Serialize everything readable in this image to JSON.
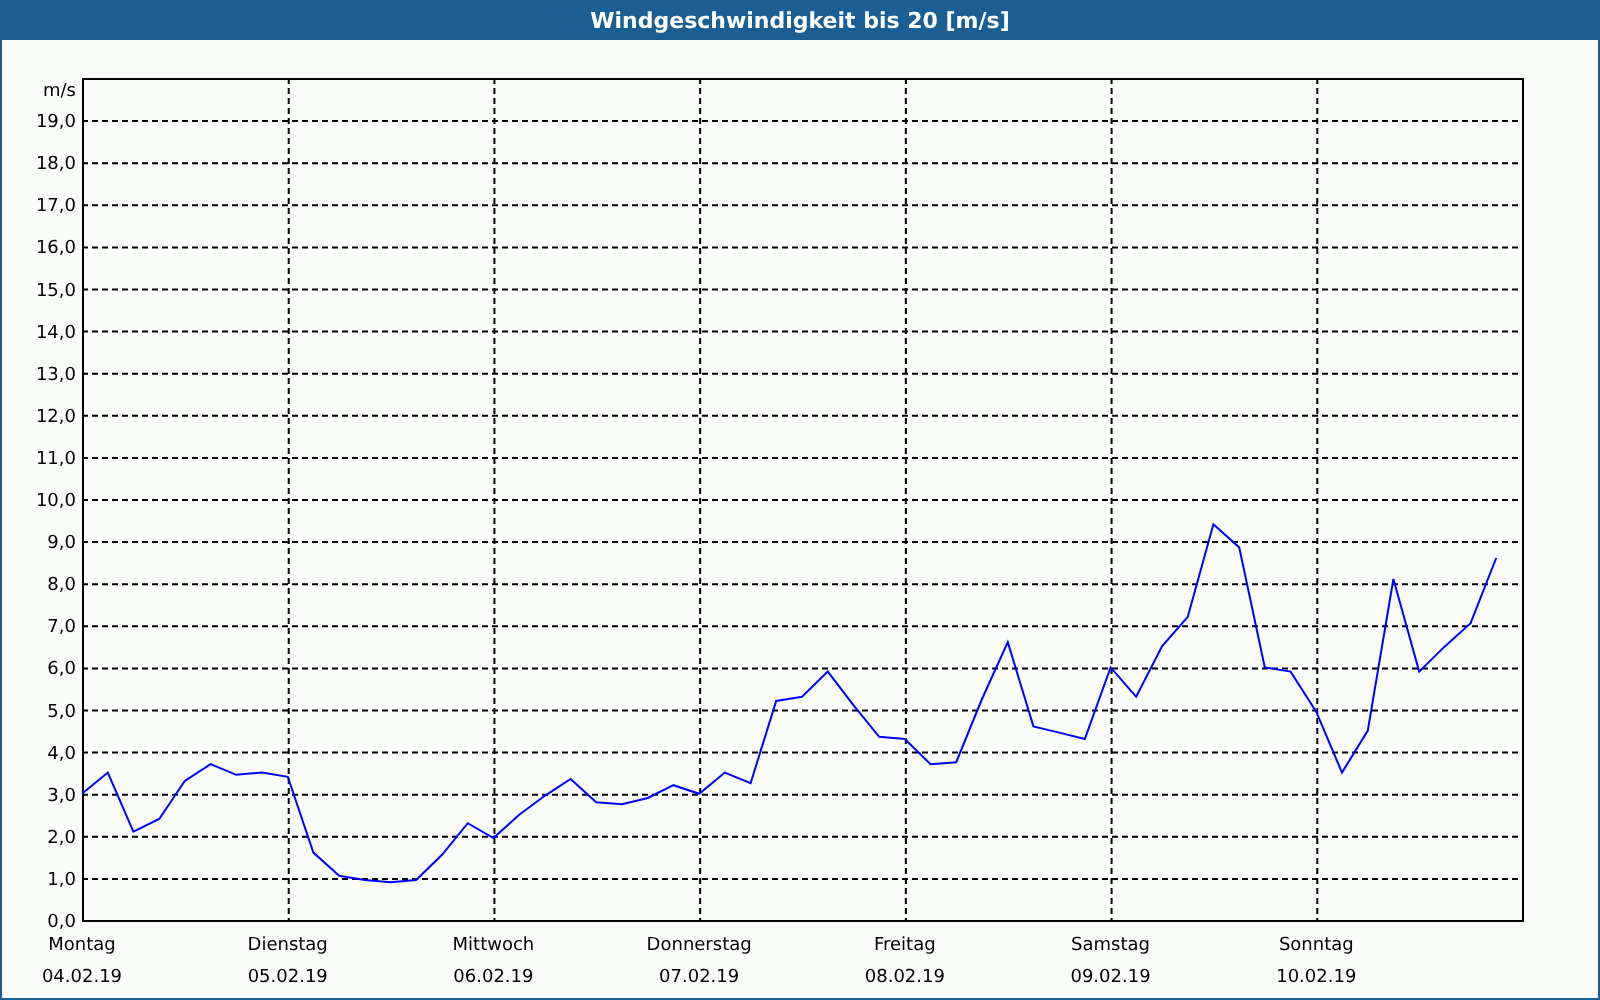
{
  "window": {
    "title": "Windgeschwindigkeit bis 20 [m/s]"
  },
  "chart": {
    "chart_data": {
      "type": "line",
      "grid": true,
      "ylabel": "m/s",
      "ylim": [
        0,
        20
      ],
      "categories": [
        "Montag\n04.02.19",
        null,
        null,
        null,
        null,
        null,
        null,
        null,
        "Dienstag\n05.02.19",
        null,
        null,
        null,
        null,
        null,
        null,
        null,
        "Mittwoch\n06.02.19",
        null,
        null,
        null,
        null,
        null,
        null,
        null,
        "Donnerstag\n07.02.19",
        null,
        null,
        null,
        null,
        null,
        null,
        null,
        "Freitag\n08.02.19",
        null,
        null,
        null,
        null,
        null,
        null,
        null,
        "Samstag\n09.02.19",
        null,
        null,
        null,
        null,
        null,
        null,
        null,
        "Sonntag\n10.02.19",
        null,
        null,
        null,
        null,
        null,
        null,
        null
      ],
      "yticks": [
        {
          "value": 0,
          "label": "0,0"
        },
        {
          "value": 1,
          "label": "1,0"
        },
        {
          "value": 2,
          "label": "2,0"
        },
        {
          "value": 3,
          "label": "3,0"
        },
        {
          "value": 4,
          "label": "4,0"
        },
        {
          "value": 5,
          "label": "5,0"
        },
        {
          "value": 6,
          "label": "6,0"
        },
        {
          "value": 7,
          "label": "7,0"
        },
        {
          "value": 8,
          "label": "8,0"
        },
        {
          "value": 9,
          "label": "9,0"
        },
        {
          "value": 10,
          "label": "10,0"
        },
        {
          "value": 11,
          "label": "11,0"
        },
        {
          "value": 12,
          "label": "12,0"
        },
        {
          "value": 13,
          "label": "13,0"
        },
        {
          "value": 14,
          "label": "14,0"
        },
        {
          "value": 15,
          "label": "15,0"
        },
        {
          "value": 16,
          "label": "16,0"
        },
        {
          "value": 17,
          "label": "17,0"
        },
        {
          "value": 18,
          "label": "18,0"
        },
        {
          "value": 19,
          "label": "19,0"
        }
      ],
      "series": [
        {
          "color": "#0000ff",
          "values": [
            3.0,
            3.5,
            2.1,
            2.4,
            3.3,
            3.7,
            3.45,
            3.5,
            3.4,
            1.6,
            1.05,
            0.95,
            0.9,
            0.95,
            1.55,
            2.3,
            1.95,
            2.5,
            2.95,
            3.35,
            2.8,
            2.75,
            2.9,
            3.2,
            3.0,
            3.5,
            3.25,
            5.2,
            5.3,
            5.9,
            5.1,
            4.35,
            4.3,
            3.7,
            3.75,
            5.25,
            6.6,
            4.6,
            4.45,
            4.3,
            6.0,
            5.3,
            6.5,
            7.2,
            9.4,
            8.85,
            6.0,
            5.9,
            4.95,
            3.5,
            4.5,
            8.1,
            5.9,
            6.5,
            7.05,
            8.6
          ]
        }
      ]
    }
  }
}
